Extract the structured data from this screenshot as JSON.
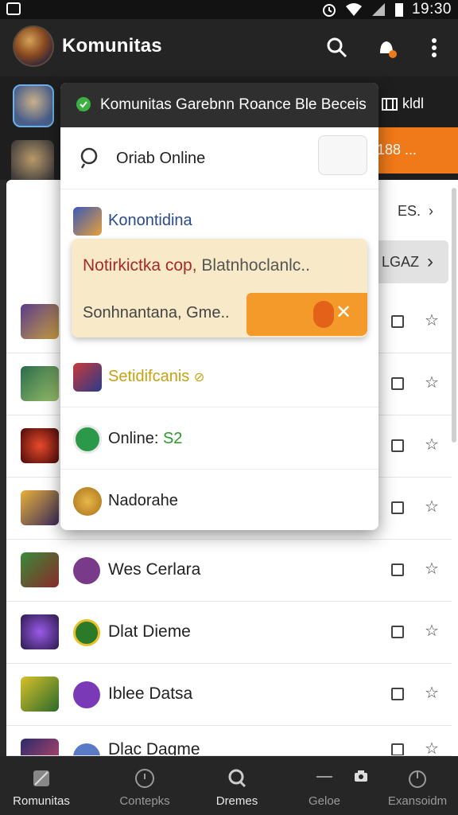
{
  "status_bar": {
    "time": "19:30"
  },
  "app_bar": {
    "title": "Komunitas"
  },
  "background": {
    "chip_label": "kldl",
    "orange_label": "188 ...",
    "peek_row1": "ES.",
    "peek_row2": "LGAZ"
  },
  "popup": {
    "header": "Komunitas Garebnn Roance Ble Beceis",
    "search_row": "Oriab Online",
    "community_row": "Konontidina",
    "notification": {
      "title_red": "Notirkictka cop,",
      "title_gray": "Blatnhoclanlc..",
      "subtitle": "Sonhnantana, Gme.."
    },
    "settings_row": "Setidifcanis",
    "online_row_label": "Online:",
    "online_row_count": "S2",
    "last_row": "Nadorahe"
  },
  "list": {
    "rows": [
      {
        "label": "Wes Cerlara"
      },
      {
        "label": "Dlat Dieme"
      },
      {
        "label": "Iblee Datsa"
      },
      {
        "label": "Dlac Dagme"
      }
    ]
  },
  "bottom_nav": {
    "items": [
      {
        "label": "Romunitas"
      },
      {
        "label": "Contepks"
      },
      {
        "label": "Dremes"
      },
      {
        "label": "Geloe"
      },
      {
        "label": "Exansoidm"
      }
    ]
  },
  "colors": {
    "accent": "#f39a2a",
    "header": "#242424",
    "brand_red": "#a52a2a"
  }
}
